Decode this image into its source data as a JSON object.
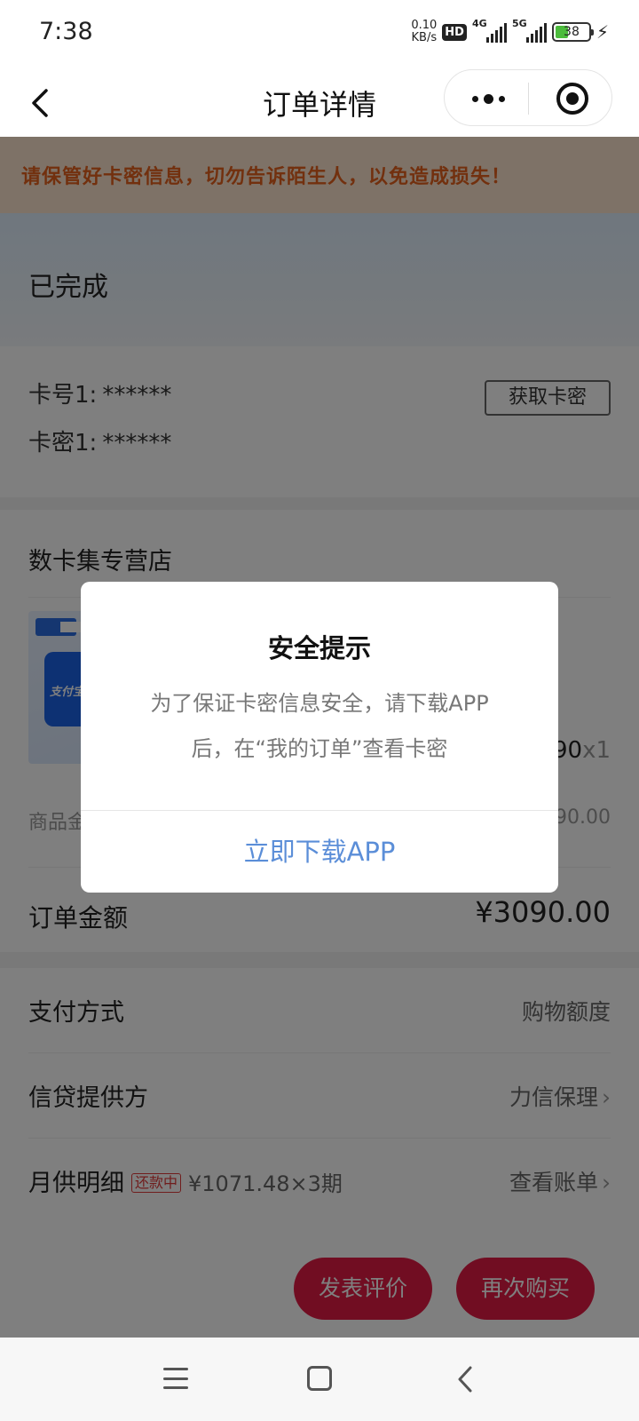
{
  "status_bar": {
    "time": "7:38",
    "net_speed_value": "0.10",
    "net_speed_unit": "KB/s",
    "hd_label": "HD",
    "sim1_label": "4G",
    "sim2_label": "5G",
    "battery_level": "38"
  },
  "nav": {
    "title": "订单详情"
  },
  "warning": {
    "text": "请保管好卡密信息，切勿告诉陌生人，以免造成损失！"
  },
  "order_status": {
    "text": "已完成"
  },
  "card_info": {
    "card_no_label": "卡号1:",
    "card_no_value": "******",
    "card_pwd_label": "卡密1:",
    "card_pwd_value": "******",
    "get_button": "获取卡密"
  },
  "shop": {
    "name": "数卡集专营店",
    "product_image_text": "支付宝",
    "price_visible": "90",
    "qty": "x1"
  },
  "summary": {
    "goods_label_visible": "商品金",
    "goods_value_visible": "90.00",
    "total_label": "订单金额",
    "total_value": "¥3090.00"
  },
  "payment": {
    "method_label": "支付方式",
    "method_value": "购物额度",
    "provider_label": "信贷提供方",
    "provider_value": "力信保理",
    "monthly_label": "月供明细",
    "monthly_badge": "还款中",
    "monthly_amount": "¥1071.48×3期",
    "monthly_link": "查看账单"
  },
  "actions": {
    "review": "发表评价",
    "rebuy": "再次购买"
  },
  "modal": {
    "title": "安全提示",
    "body_line1": "为了保证卡密信息安全，请下载APP",
    "body_line2": "后，在“我的订单”查看卡密",
    "button": "立即下载APP"
  },
  "colors": {
    "accent_red": "#e31b45",
    "warning_orange": "#e4601c",
    "modal_link_blue": "#5b8ed8"
  }
}
